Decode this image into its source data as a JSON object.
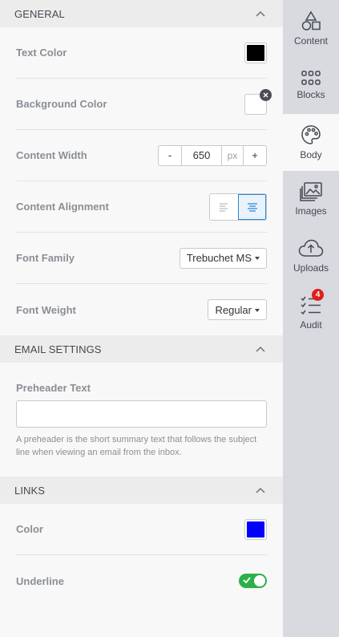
{
  "sections": {
    "general": {
      "title": "GENERAL",
      "text_color": {
        "label": "Text Color",
        "value": "#000000"
      },
      "background_color": {
        "label": "Background Color",
        "value": "#ffffff"
      },
      "content_width": {
        "label": "Content Width",
        "minus": "-",
        "value": "650",
        "unit": "px",
        "plus": "+"
      },
      "content_alignment": {
        "label": "Content Alignment",
        "selected": "center"
      },
      "font_family": {
        "label": "Font Family",
        "value": "Trebuchet MS"
      },
      "font_weight": {
        "label": "Font Weight",
        "value": "Regular"
      }
    },
    "email_settings": {
      "title": "EMAIL SETTINGS",
      "preheader": {
        "label": "Preheader Text",
        "value": "",
        "hint": "A preheader is the short summary text that follows the subject line when viewing an email from the inbox."
      }
    },
    "links": {
      "title": "LINKS",
      "color": {
        "label": "Color",
        "value": "#0000ff"
      },
      "underline": {
        "label": "Underline",
        "enabled": true
      }
    }
  },
  "sidebar": {
    "items": [
      {
        "label": "Content",
        "icon": "shapes-icon"
      },
      {
        "label": "Blocks",
        "icon": "grid-icon"
      },
      {
        "label": "Body",
        "icon": "palette-icon",
        "active": true
      },
      {
        "label": "Images",
        "icon": "images-icon"
      },
      {
        "label": "Uploads",
        "icon": "cloud-upload-icon"
      },
      {
        "label": "Audit",
        "icon": "checklist-icon",
        "badge": "4"
      }
    ]
  },
  "colors": {
    "accent": "#2b86d6",
    "toggle_on": "#2bb04a",
    "badge": "#e01d1d"
  }
}
